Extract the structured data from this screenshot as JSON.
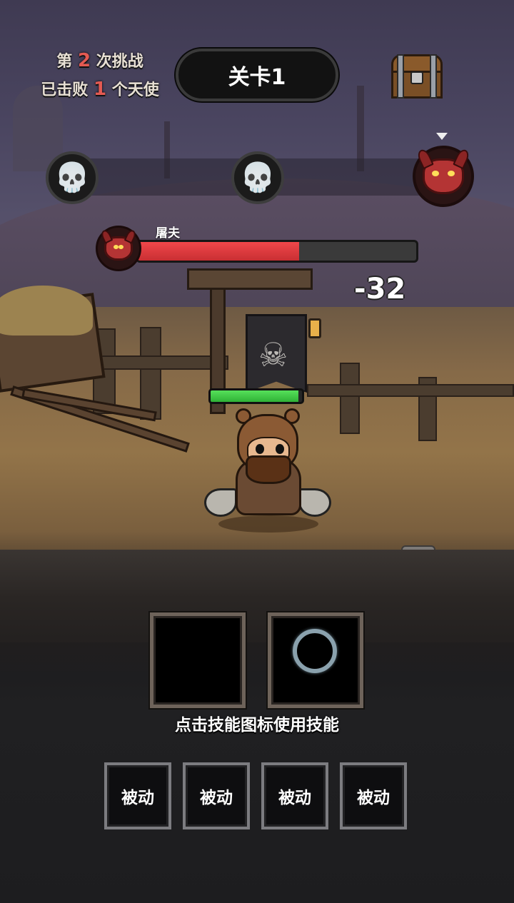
{
  "hud": {
    "challenge_prefix": "第",
    "challenge_count": "2",
    "challenge_suffix": "次挑战",
    "defeated_prefix": "已击败",
    "defeated_count": "1",
    "defeated_suffix": "个天使",
    "level_label": "关卡1"
  },
  "wave_track": {
    "nodes": [
      {
        "type": "minion",
        "icon": "skull-icon",
        "glyph": "💀"
      },
      {
        "type": "minion",
        "icon": "skull-icon",
        "glyph": "💀"
      },
      {
        "type": "boss",
        "icon": "demon-boss-icon",
        "current": true
      }
    ]
  },
  "enemy": {
    "name": "屠夫",
    "hp_fraction": 0.58,
    "bar_color": "#e83c40"
  },
  "damage_popup": "-32",
  "hero": {
    "hp_fraction": 0.96,
    "bar_color": "#45d04a"
  },
  "skills": {
    "slots": [
      {
        "name": "skill-slot-1",
        "state": "empty"
      },
      {
        "name": "skill-slot-2",
        "state": "cooldown"
      }
    ],
    "hint": "点击技能图标使用技能"
  },
  "passives": {
    "labels": [
      "被动",
      "被动",
      "被动",
      "被动"
    ]
  }
}
